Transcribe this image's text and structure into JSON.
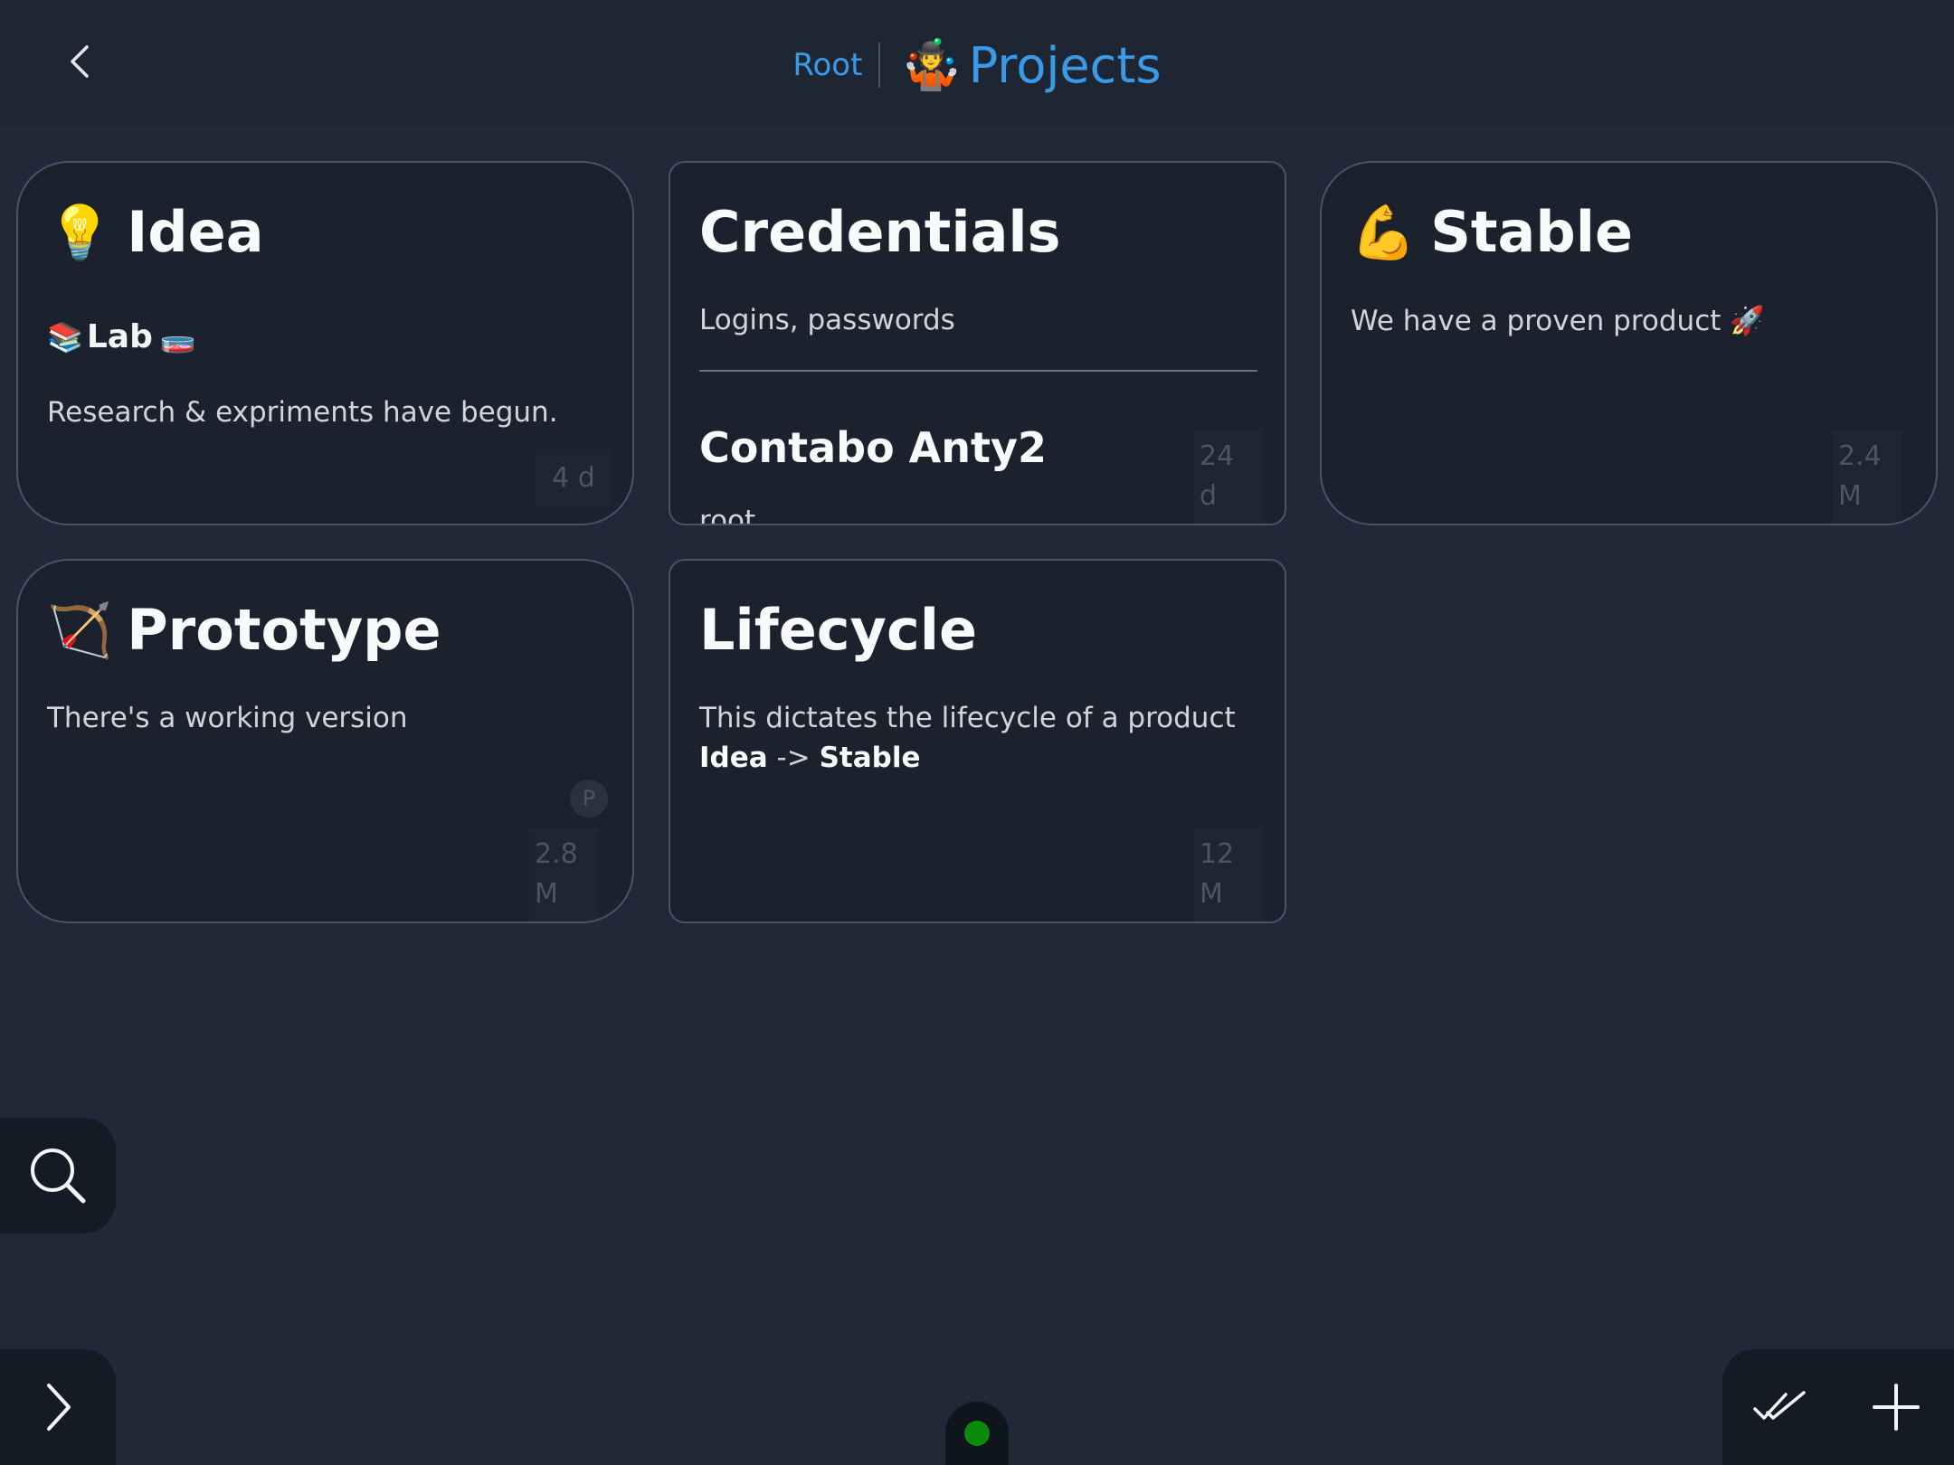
{
  "header": {
    "root_crumb": "Root",
    "current_emoji": "🤹",
    "current_title": "Projects"
  },
  "cards": {
    "idea": {
      "emoji": "💡",
      "title": "Idea",
      "sub_emoji_left": "📚",
      "sub_title": "Lab",
      "sub_emoji_right": "🧫",
      "description": "Research & expriments have begun.",
      "age": "4 d"
    },
    "credentials": {
      "title": "Credentials",
      "description": "Logins, passwords",
      "nested_title": "Contabo Anty2",
      "nested_sub": "root",
      "age": "24 d"
    },
    "stable": {
      "emoji": "💪",
      "title": "Stable",
      "description": "We have a proven product",
      "description_emoji": "🚀",
      "age": "2.4 M"
    },
    "prototype": {
      "emoji": "🏹",
      "title": "Prototype",
      "description": "There's a working version",
      "badge": "P",
      "age": "2.8 M"
    },
    "lifecycle": {
      "title": "Lifecycle",
      "description": "This dictates the lifecycle of a product",
      "flow_from": "Idea",
      "flow_arrow": "->",
      "flow_to": "Stable",
      "age": "12 M"
    }
  },
  "status": {
    "color": "#0c8a0c"
  },
  "icons": {
    "back": "chevron-left-icon",
    "search": "search-icon",
    "expand": "chevron-right-icon",
    "mark_all": "double-check-icon",
    "add": "plus-icon"
  },
  "colors": {
    "background": "#1f2937",
    "accent": "#3b9ae8",
    "card_background": "#1b222d",
    "card_border": "#475569"
  }
}
